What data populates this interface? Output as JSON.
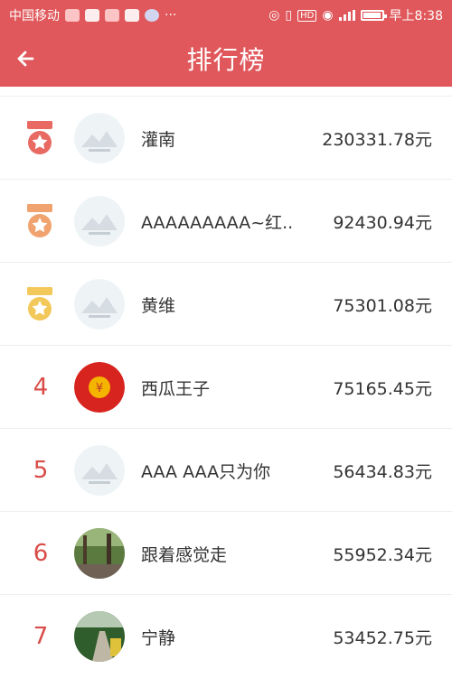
{
  "status_bar": {
    "carrier": "中国移动",
    "time": "早上8:38",
    "dots": "···"
  },
  "header": {
    "title": "排行榜"
  },
  "rows": [
    {
      "rank": "",
      "medal": "red",
      "name": "灌南",
      "amount": "230331.78元",
      "avatar": "placeholder"
    },
    {
      "rank": "",
      "medal": "orange",
      "name": "AAAAAAAAA~红...",
      "amount": "92430.94元",
      "avatar": "placeholder"
    },
    {
      "rank": "",
      "medal": "gold",
      "name": "黄维",
      "amount": "75301.08元",
      "avatar": "placeholder"
    },
    {
      "rank": "4",
      "medal": "",
      "name": "西瓜王子",
      "amount": "75165.45元",
      "avatar": "coin"
    },
    {
      "rank": "5",
      "medal": "",
      "name": "AAA AAA只为你",
      "amount": "56434.83元",
      "avatar": "placeholder"
    },
    {
      "rank": "6",
      "medal": "",
      "name": "跟着感觉走",
      "amount": "55952.34元",
      "avatar": "photo-forest"
    },
    {
      "rank": "7",
      "medal": "",
      "name": "宁静",
      "amount": "53452.75元",
      "avatar": "photo-road"
    }
  ],
  "colors": {
    "primary": "#e0585b",
    "medal_red": "#e86a62",
    "medal_orange": "#f0a36f",
    "medal_gold": "#f3c85b"
  }
}
